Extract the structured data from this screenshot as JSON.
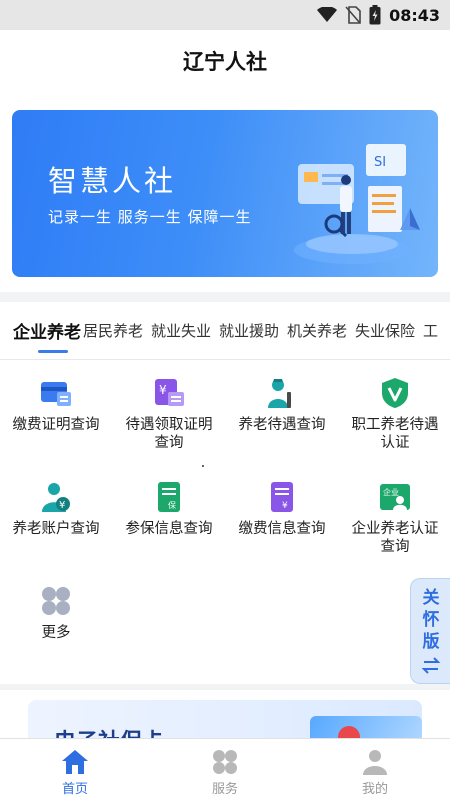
{
  "status_bar": {
    "time": "08:43",
    "icons": [
      "wifi-icon",
      "no-sim-icon",
      "battery-charging-icon"
    ]
  },
  "header": {
    "title": "辽宁人社"
  },
  "banner": {
    "title": "智慧人社",
    "slogan": "记录一生  服务一生  保障一生"
  },
  "tabs": [
    {
      "label": "企业养老",
      "active": true
    },
    {
      "label": "居民养老"
    },
    {
      "label": "就业失业"
    },
    {
      "label": "就业援助"
    },
    {
      "label": "机关养老"
    },
    {
      "label": "失业保险"
    },
    {
      "label": "工"
    }
  ],
  "services": [
    {
      "label": "缴费证明查询",
      "icon": "payment-certificate-icon",
      "color": "#3b7bf0"
    },
    {
      "label": "待遇领取证明查询",
      "icon": "benefit-certificate-icon",
      "color": "#8a56e8"
    },
    {
      "label": "养老待遇查询",
      "icon": "pension-benefit-icon",
      "color": "#1aa5a8"
    },
    {
      "label": "职工养老待遇认证",
      "icon": "verified-shield-icon",
      "color": "#1ba86a"
    },
    {
      "label": "养老账户查询",
      "icon": "pension-account-icon",
      "color": "#1aa5a8"
    },
    {
      "label": "参保信息查询",
      "icon": "insurance-info-icon",
      "color": "#1ba86a"
    },
    {
      "label": "缴费信息查询",
      "icon": "payment-info-icon",
      "color": "#8a56e8"
    },
    {
      "label": "企业养老认证查询",
      "icon": "enterprise-verify-icon",
      "color": "#1ba86a"
    },
    {
      "label": "更多",
      "icon": "more-grid-icon",
      "color": "#a9b0c2"
    }
  ],
  "care_mode": {
    "label": "关怀版"
  },
  "ecard": {
    "title": "电子社保卡"
  },
  "bottom_nav": [
    {
      "label": "首页",
      "icon": "home-icon",
      "active": true
    },
    {
      "label": "服务",
      "icon": "services-grid-icon",
      "active": false
    },
    {
      "label": "我的",
      "icon": "profile-icon",
      "active": false
    }
  ],
  "colors": {
    "accent": "#2f6ee0",
    "banner": "#3e8ef8"
  }
}
